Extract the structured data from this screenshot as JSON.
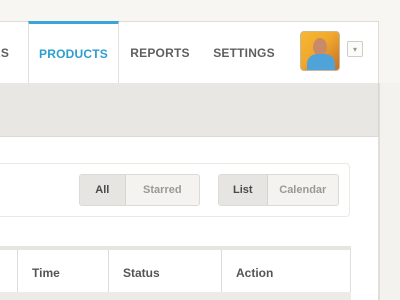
{
  "nav": {
    "items": [
      {
        "label": "RS",
        "active": false
      },
      {
        "label": "PRODUCTS",
        "active": true
      },
      {
        "label": "REPORTS",
        "active": false
      },
      {
        "label": "SETTINGS",
        "active": false
      }
    ],
    "dropdown_glyph": "▾"
  },
  "filters": {
    "view_group": {
      "options": [
        "All",
        "Starred"
      ],
      "selected": "All"
    },
    "layout_group": {
      "options": [
        "List",
        "Calendar"
      ],
      "selected": "List"
    }
  },
  "table": {
    "columns": [
      "",
      "Time",
      "Status",
      "Action"
    ]
  },
  "colors": {
    "accent": "#3aa6d6",
    "band": "#e8e7e3",
    "background": "#ffffff"
  }
}
